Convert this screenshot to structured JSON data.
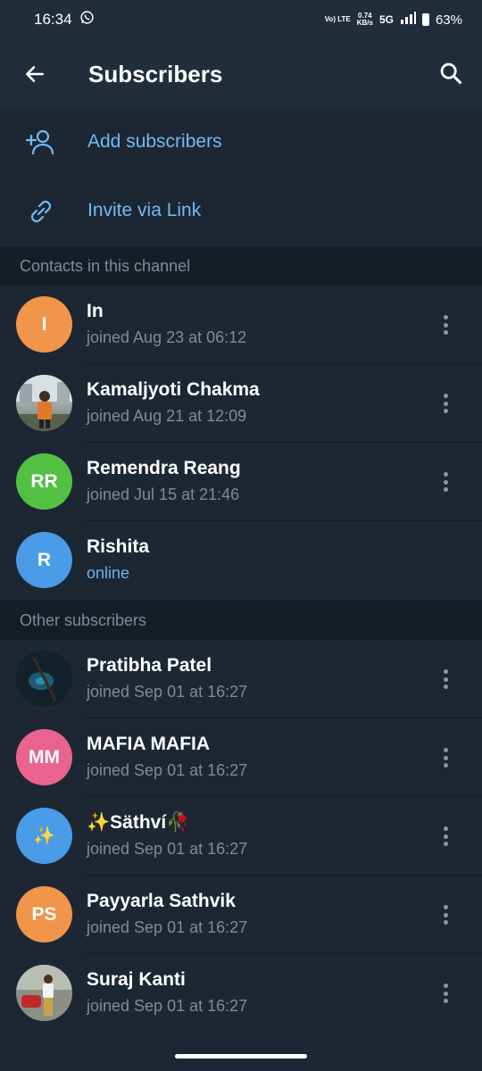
{
  "status_bar": {
    "time": "16:34",
    "network_top": "Vo) LTE",
    "speed_value": "0.74",
    "speed_unit": "KB/s",
    "network_type": "5G",
    "battery": "63%"
  },
  "app_bar": {
    "title": "Subscribers",
    "back_icon": "arrow-left-icon",
    "search_icon": "search-icon"
  },
  "actions": [
    {
      "label": "Add subscribers",
      "icon": "add-person-icon"
    },
    {
      "label": "Invite via Link",
      "icon": "link-icon"
    }
  ],
  "sections": {
    "contacts_header": "Contacts in this channel",
    "other_header": "Other subscribers"
  },
  "contacts": [
    {
      "name": "In",
      "status": "joined Aug 23 at 06:12",
      "avatar_text": "I",
      "avatar_color": "#f0954a"
    },
    {
      "name": "Kamaljyoti Chakma",
      "status": "joined Aug 21 at 12:09",
      "avatar_text": "",
      "avatar_color": "#7f8a8f"
    },
    {
      "name": "Remendra Reang",
      "status": "joined Jul 15 at 21:46",
      "avatar_text": "RR",
      "avatar_color": "#52c143"
    },
    {
      "name": "Rishita",
      "status": "online",
      "avatar_text": "R",
      "avatar_color": "#4a9be8"
    }
  ],
  "others": [
    {
      "name": "Pratibha Patel",
      "status": "joined Sep 01 at 16:27",
      "avatar_text": "",
      "avatar_color": "#1a2a33"
    },
    {
      "name": "MAFIA MAFIA",
      "status": "joined Sep 01 at 16:27",
      "avatar_text": "MM",
      "avatar_color": "#e8648e"
    },
    {
      "name": "✨Säthví🥀",
      "status": "joined Sep 01 at 16:27",
      "avatar_text": "✨",
      "avatar_color": "#4a9be8"
    },
    {
      "name": "Payyarla Sathvik",
      "status": "joined Sep 01 at 16:27",
      "avatar_text": "PS",
      "avatar_color": "#f0954a"
    },
    {
      "name": "Suraj Kanti",
      "status": "joined Sep 01 at 16:27",
      "avatar_text": "",
      "avatar_color": "#6b6f66"
    }
  ]
}
